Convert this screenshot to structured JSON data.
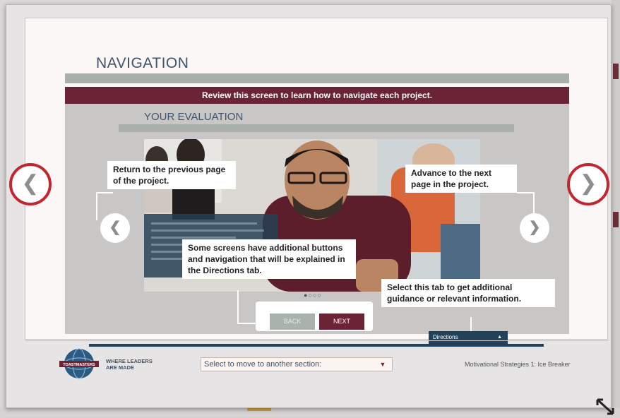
{
  "slide": {
    "title": "NAVIGATION",
    "banner": "Review this screen to learn how to navigate each project.",
    "section_title": "YOUR EVALUATION",
    "pager": "●○○○"
  },
  "callouts": {
    "previous": "Return to the previous page of the project.",
    "next": "Advance to the next page in the project.",
    "additional": "Some screens have additional buttons and navigation that will be explained in the Directions tab.",
    "directions": "Select this tab to get additional guidance or relevant information."
  },
  "buttons": {
    "back": "BACK",
    "next": "NEXT",
    "directions_tab": "Directions",
    "prev_arrow": "❮",
    "next_arrow": "❯"
  },
  "footer": {
    "tagline_line1": "WHERE LEADERS",
    "tagline_line2": "ARE MADE",
    "section_select_value": "Select to move to another section:",
    "project_name": "Motivational Strategies 1: Ice Breaker"
  },
  "colors": {
    "accent": "#6b2436",
    "navy": "#22425c",
    "highlight_ring": "#c2262f"
  }
}
